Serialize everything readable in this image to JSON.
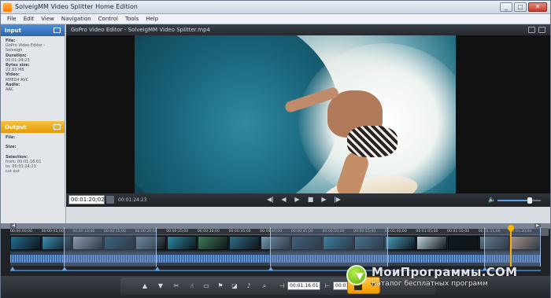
{
  "window": {
    "title": "SolveigMM Video Splitter Home Edition",
    "controls": [
      "_",
      "□",
      "✕"
    ]
  },
  "menu": [
    "File",
    "Edit",
    "View",
    "Navigation",
    "Control",
    "Tools",
    "Help"
  ],
  "input_panel": {
    "title": "Input",
    "file_label": "File:",
    "file_value": "GoPro Video Editor - Solveigh",
    "duration_label": "Duration:",
    "duration_value": "00:01:24:23",
    "size_label": "Bytes size:",
    "size_value": "22.83 MB",
    "video_label": "Video:",
    "video_value": "MPEG4 AVC",
    "audio_label": "Audio:",
    "audio_value": "AAC"
  },
  "output_panel": {
    "title": "Output",
    "file_label": "File:",
    "size_label": "Size:",
    "selection_label": "Selection:",
    "from_value": "from: 00:01:16:01",
    "to_value": "to: 00:01:24:23",
    "cut_value": "cut out"
  },
  "player": {
    "title": "GoPro Video Editor - SolveigMM Video Splitter.mp4",
    "current_time": "00:01:20;02",
    "total_time": "00:01:24:23",
    "volume": 0.75
  },
  "timeline": {
    "ticks": [
      "00:00:00;00",
      "00:00:05;00",
      "00:00:10;00",
      "00:00:15;00",
      "00:00:20;00",
      "00:00:25;00",
      "00:00:30;00",
      "00:00:35;00",
      "00:00:40;00",
      "00:00:45;00",
      "00:00:50;00",
      "00:00:55;00",
      "00:01:00;00",
      "00:01:05;00",
      "00:01:10;00",
      "00:01:15;00",
      "00:01:20;00"
    ],
    "thumb_colors": [
      "#1f6f93",
      "#3b8fb4",
      "#9aa9b4",
      "#24556d",
      "#6c8a9a",
      "#2a8aa5",
      "#3f7a5a",
      "#2f6f88",
      "#7aa0b5",
      "#284f69",
      "#1c7fa0",
      "#356c85",
      "#4aa0c0",
      "#bfd3dd",
      "#0e1a22",
      "#5f7d8c",
      "#c59a7b"
    ]
  },
  "bottom": {
    "time_from": "00:01:16:01",
    "time_to": "00:01:24:23"
  },
  "watermark": {
    "line1": "МоиПрограммы.COM",
    "line2": "Каталог бесплатных программ"
  }
}
